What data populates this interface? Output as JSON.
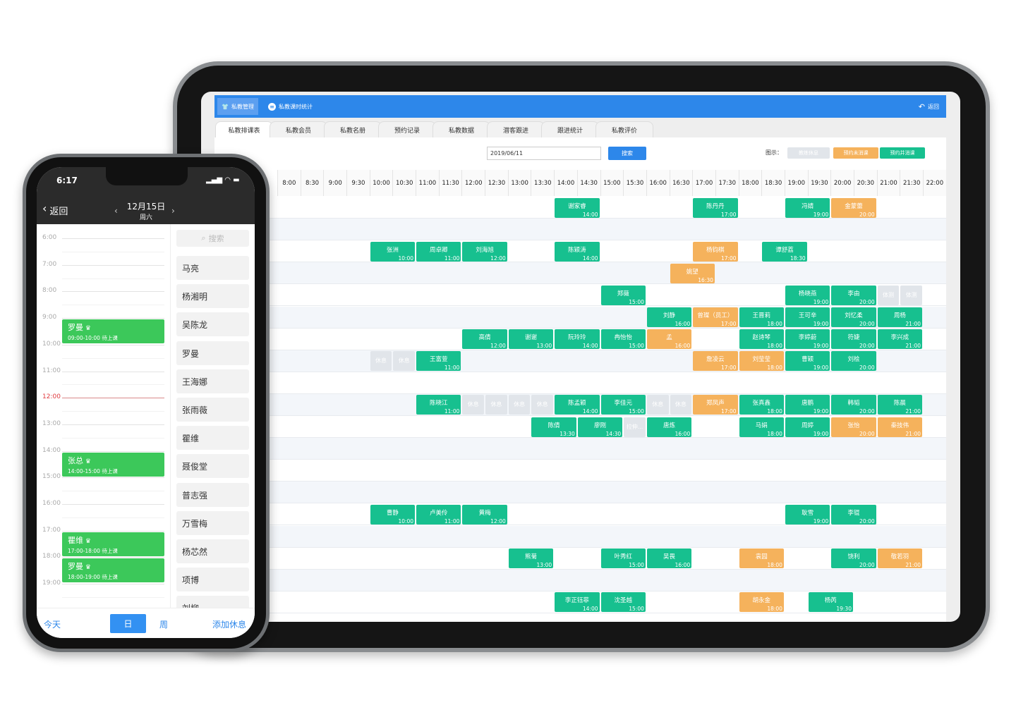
{
  "tablet": {
    "topbar": {
      "items": [
        "私教管理",
        "私教课时统计"
      ],
      "back_label": "返回"
    },
    "tabs": [
      "私教排课表",
      "私教会员",
      "私教名册",
      "预约记录",
      "私教数据",
      "潜客跟进",
      "跟进统计",
      "私教评价"
    ],
    "active_tab": 0,
    "date_value": "2019/06/11",
    "search_label": "搜索",
    "legend": {
      "label": "图示：",
      "items": [
        {
          "label": "教练休息",
          "color": "#e1e5ea"
        },
        {
          "label": "预约未消课",
          "color": "#f5b25c"
        },
        {
          "label": "预约并消课",
          "color": "#17c08f"
        }
      ]
    },
    "times": [
      "8:00",
      "8:30",
      "9:00",
      "9:30",
      "10:00",
      "10:30",
      "11:00",
      "11:30",
      "12:00",
      "12:30",
      "13:00",
      "13:30",
      "14:00",
      "14:30",
      "15:00",
      "15:30",
      "16:00",
      "16:30",
      "17:00",
      "17:30",
      "18:00",
      "18:30",
      "19:00",
      "19:30",
      "20:00",
      "20:30",
      "21:00",
      "21:30",
      "22:00"
    ],
    "status_colors": {
      "done": "#17c08f",
      "booked": "#f5b25c",
      "rest": "#e1e5ea"
    },
    "rows": [
      [
        [
          "谢家睿",
          "14:00",
          "done"
        ],
        [
          "陈丹丹",
          "17:00",
          "done"
        ],
        [
          "冯婧",
          "19:00",
          "done"
        ],
        [
          "金蒙蕾",
          "20:00",
          "booked"
        ]
      ],
      [],
      [
        [
          "张洲",
          "10:00",
          "done"
        ],
        [
          "周卓卿",
          "11:00",
          "done"
        ],
        [
          "刘海旭",
          "12:00",
          "done"
        ],
        [
          "陈颖涛",
          "14:00",
          "done"
        ],
        [
          "杨钧棋",
          "17:00",
          "booked"
        ],
        [
          "谭舒荔",
          "18:30",
          "done"
        ]
      ],
      [
        [
          "姚望",
          "16:30",
          "booked"
        ]
      ],
      [
        [
          "郑薇",
          "15:00",
          "done"
        ],
        [
          "杨晓燕",
          "19:00",
          "done"
        ],
        [
          "李由",
          "20:00",
          "done"
        ],
        [
          "体测",
          "21:00",
          "rest"
        ],
        [
          "体测",
          "21:30",
          "rest"
        ]
      ],
      [
        [
          "刘静",
          "16:00",
          "done"
        ],
        [
          "曾璨（员工）",
          "17:00",
          "booked"
        ],
        [
          "王晋莉",
          "18:00",
          "done"
        ],
        [
          "王可辛",
          "19:00",
          "done"
        ],
        [
          "刘忆柔",
          "20:00",
          "done"
        ],
        [
          "周杨",
          "21:00",
          "done"
        ]
      ],
      [
        [
          "高倩",
          "12:00",
          "done"
        ],
        [
          "谢谢",
          "13:00",
          "done"
        ],
        [
          "阮玲玲",
          "14:00",
          "done"
        ],
        [
          "冉怡怡",
          "15:00",
          "done"
        ],
        [
          "孟",
          "16:00",
          "booked"
        ],
        [
          "赵诗琴",
          "18:00",
          "done"
        ],
        [
          "李婷蔚",
          "19:00",
          "done"
        ],
        [
          "符婕",
          "20:00",
          "done"
        ],
        [
          "李兴成",
          "21:00",
          "done"
        ]
      ],
      [
        [
          "休息",
          "10:00",
          "rest"
        ],
        [
          "休息",
          "10:30",
          "rest"
        ],
        [
          "王富萱",
          "11:00",
          "done"
        ],
        [
          "詹凌云",
          "17:00",
          "booked"
        ],
        [
          "刘莹莹",
          "18:00",
          "booked"
        ],
        [
          "曹颖",
          "19:00",
          "done"
        ],
        [
          "刘桧",
          "20:00",
          "done"
        ]
      ],
      [],
      [
        [
          "陈晓江",
          "11:00",
          "done"
        ],
        [
          "休息",
          "12:00",
          "rest"
        ],
        [
          "休息",
          "12:30",
          "rest"
        ],
        [
          "休息",
          "13:00",
          "rest"
        ],
        [
          "休息",
          "13:30",
          "rest"
        ],
        [
          "陈孟颖",
          "14:00",
          "done"
        ],
        [
          "李佳元",
          "15:00",
          "done"
        ],
        [
          "休息",
          "16:00",
          "rest"
        ],
        [
          "休息",
          "16:30",
          "rest"
        ],
        [
          "郑凤声",
          "17:00",
          "booked"
        ],
        [
          "张真鑫",
          "18:00",
          "done"
        ],
        [
          "唐鹏",
          "19:00",
          "done"
        ],
        [
          "韩韬",
          "20:00",
          "done"
        ],
        [
          "陈晨",
          "21:00",
          "done"
        ]
      ],
      [
        [
          "陈倩",
          "13:30",
          "done"
        ],
        [
          "廖刚",
          "14:30",
          "done"
        ],
        [
          "拉伸...",
          "15:30",
          "rest"
        ],
        [
          "唐炼",
          "16:00",
          "done"
        ],
        [
          "马娟",
          "18:00",
          "done"
        ],
        [
          "周婷",
          "19:00",
          "done"
        ],
        [
          "张怡",
          "20:00",
          "booked"
        ],
        [
          "秦技伟",
          "21:00",
          "booked"
        ]
      ],
      [],
      [],
      [],
      [
        [
          "曹静",
          "10:00",
          "done"
        ],
        [
          "卢美伶",
          "11:00",
          "done"
        ],
        [
          "黄梅",
          "12:00",
          "done"
        ],
        [
          "耿雪",
          "19:00",
          "done"
        ],
        [
          "李锟",
          "20:00",
          "done"
        ]
      ],
      [],
      [
        [
          "熊菊",
          "13:00",
          "done"
        ],
        [
          "叶秀红",
          "15:00",
          "done"
        ],
        [
          "吴畏",
          "16:00",
          "done"
        ],
        [
          "袁园",
          "18:00",
          "booked"
        ],
        [
          "饶利",
          "20:00",
          "done"
        ],
        [
          "敬若羽",
          "21:00",
          "booked"
        ]
      ],
      [],
      [
        [
          "李正钰菲",
          "14:00",
          "done"
        ],
        [
          "沈圣越",
          "15:00",
          "done"
        ],
        [
          "胡永金",
          "18:00",
          "booked"
        ],
        [
          "杨芮",
          "19:30",
          "done"
        ]
      ]
    ]
  },
  "phone": {
    "status_time": "6:17",
    "back_label": "返回",
    "date": "12月15日",
    "weekday": "周六",
    "hours": [
      "6:00",
      "7:00",
      "8:00",
      "9:00",
      "10:00",
      "11:00",
      "12:00",
      "13:00",
      "14:00",
      "15:00",
      "16:00",
      "17:00",
      "18:00",
      "19:00"
    ],
    "current_hour": "12:00",
    "events": [
      {
        "name": "罗曼",
        "time": "09:00-10:00 待上课",
        "start": 9
      },
      {
        "name": "张总",
        "time": "14:00-15:00 待上课",
        "start": 14
      },
      {
        "name": "瞿维",
        "time": "17:00-18:00 待上课",
        "start": 17
      },
      {
        "name": "罗曼",
        "time": "18:00-19:00 待上课",
        "start": 18
      }
    ],
    "search_placeholder": "搜索",
    "coaches": [
      "马亮",
      "杨湘明",
      "吴陈龙",
      "罗曼",
      "王海娜",
      "张雨薇",
      "瞿维",
      "聂俊堂",
      "普志强",
      "万雪梅",
      "杨芯然",
      "项博",
      "刘柳"
    ],
    "bottom": {
      "today": "今天",
      "day": "日",
      "week": "周",
      "add_rest": "添加休息"
    }
  }
}
